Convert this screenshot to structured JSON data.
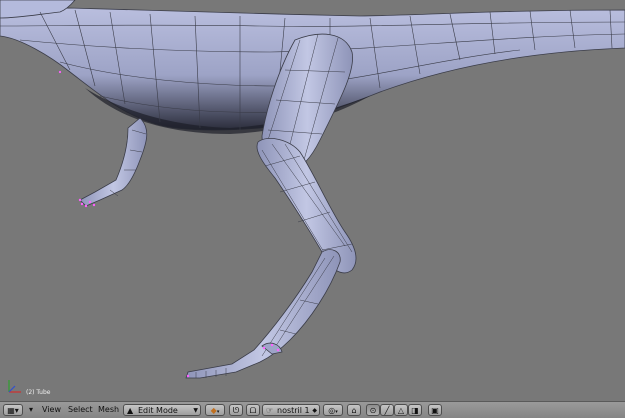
{
  "viewport": {
    "object_label": "(2) Tube"
  },
  "header": {
    "menus": [
      "View",
      "Select",
      "Mesh"
    ],
    "mode_dropdown": {
      "value": "Edit Mode",
      "icon": "edit-mode-icon"
    },
    "layer_dropdown": {
      "value": "nostril 1",
      "icon": "hand-icon"
    }
  },
  "colors": {
    "viewport_bg": "#787878",
    "mesh_fill": "#aab0d0",
    "wire": "#3a3c48",
    "selected_vertex": "#ff60ff",
    "header_bg": "#8f8f8f"
  }
}
